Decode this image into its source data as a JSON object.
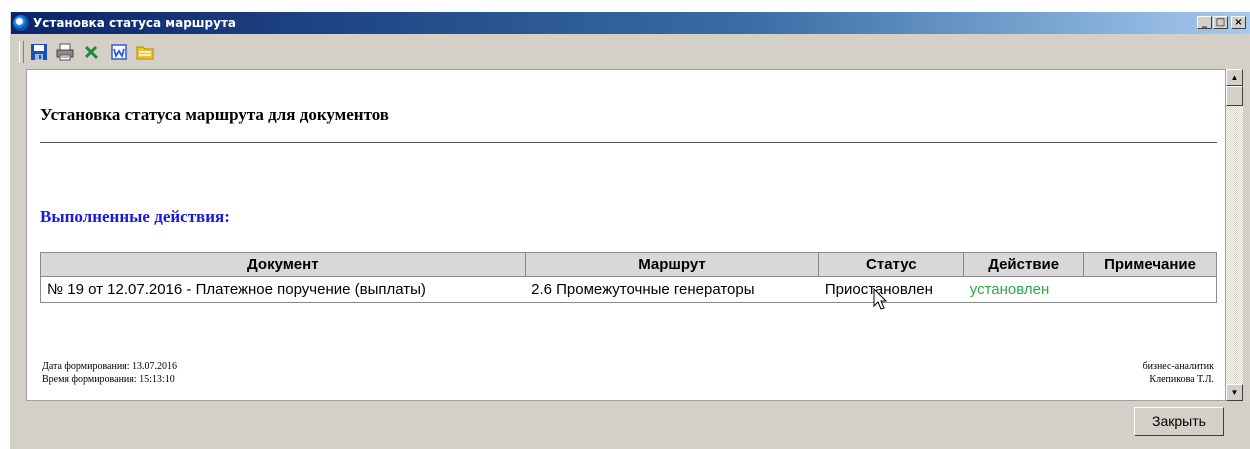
{
  "window": {
    "title": "Установка статуса маршрута",
    "controls": {
      "minimize": "_",
      "maximize": "□",
      "close": "×"
    }
  },
  "toolbar": {
    "items": [
      {
        "icon": "save-icon"
      },
      {
        "icon": "print-icon"
      },
      {
        "icon": "excel-icon"
      },
      {
        "icon": "word-icon"
      },
      {
        "icon": "folder-icon"
      }
    ]
  },
  "report": {
    "title": "Установка статуса маршрута для документов",
    "section_title": "Выполненные действия:",
    "table": {
      "headers": [
        "Документ",
        "Маршрут",
        "Статус",
        "Действие",
        "Примечание"
      ],
      "rows": [
        [
          "№ 19 от 12.07.2016 - Платежное поручение (выплаты)",
          "2.6 Промежуточные генераторы",
          "Приостановлен",
          "установлен",
          ""
        ]
      ]
    },
    "footer": {
      "date_line": "Дата формирования: 13.07.2016",
      "time_line": "Время формирования: 15:13:10",
      "role": "бизнес-аналитик",
      "author": "Клепикова Т.Л."
    }
  },
  "buttons": {
    "close": "Закрыть"
  },
  "colors": {
    "titlebar": "#0a246a",
    "section_title": "#1a1adb",
    "action_status": "#2ea84a",
    "window_bg": "#d4d0c8"
  }
}
